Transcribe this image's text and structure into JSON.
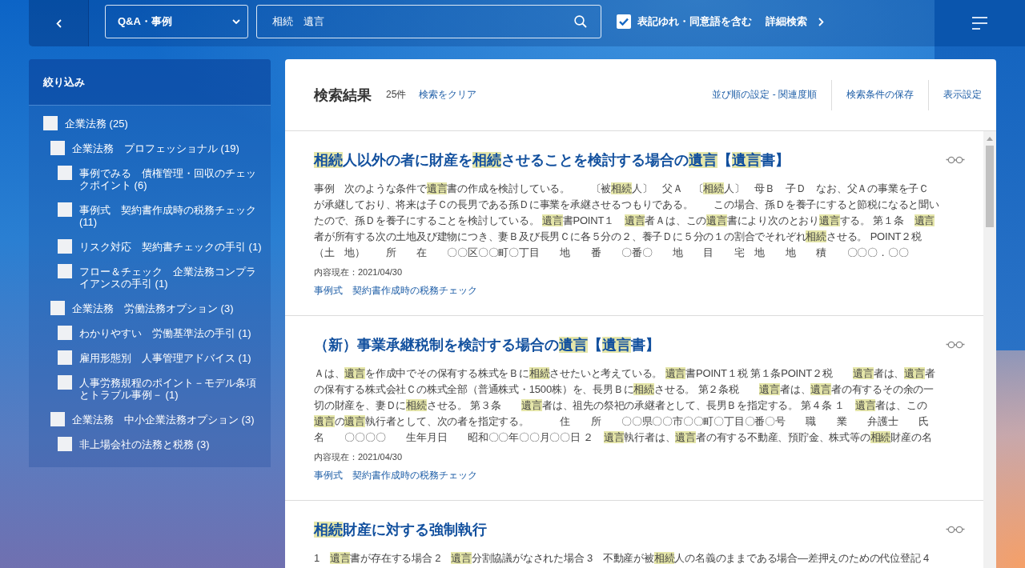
{
  "top_bar": {
    "category_select": {
      "value": "Q&A・事例"
    },
    "search": {
      "value": "相続　遺言"
    },
    "variant_option": {
      "label": "表記ゆれ・同意語を含む",
      "checked": true
    },
    "advanced_search": "詳細検索"
  },
  "sidebar": {
    "title": "絞り込み",
    "items": [
      {
        "label": "企業法務 (25)",
        "checked": false,
        "children": [
          {
            "label": "企業法務　プロフェッショナル (19)",
            "checked": false,
            "children": [
              {
                "label": "事例でみる　債権管理・回収のチェックポイント (6)",
                "checked": false
              },
              {
                "label": "事例式　契約書作成時の税務チェック (11)",
                "checked": false
              },
              {
                "label": "リスク対応　契約書チェックの手引 (1)",
                "checked": false
              },
              {
                "label": "フロー＆チェック　企業法務コンプライアンスの手引 (1)",
                "checked": false
              }
            ]
          },
          {
            "label": "企業法務　労働法務オプション (3)",
            "checked": false,
            "children": [
              {
                "label": "わかりやすい　労働基準法の手引 (1)",
                "checked": false
              },
              {
                "label": "雇用形態別　人事管理アドバイス (1)",
                "checked": false
              },
              {
                "label": "人事労務規程のポイント－モデル条項とトラブル事例－ (1)",
                "checked": false
              }
            ]
          },
          {
            "label": "企業法務　中小企業法務オプション (3)",
            "checked": false,
            "children": [
              {
                "label": "非上場会社の法務と税務 (3)",
                "checked": false
              }
            ]
          }
        ]
      }
    ]
  },
  "results": {
    "title": "検索結果",
    "count": "25件",
    "clear": "検索をクリア",
    "actions": [
      "並び順の設定 - 関連度順",
      "検索条件の保存",
      "表示設定"
    ],
    "items": [
      {
        "title": [
          {
            "text": "相続",
            "highlighted": true
          },
          {
            "text": "人以外の者に財産を",
            "highlighted": false
          },
          {
            "text": "相続",
            "highlighted": true
          },
          {
            "text": "させることを検討する場合の",
            "highlighted": false
          },
          {
            "text": "遺言",
            "highlighted": true
          },
          {
            "text": "【",
            "highlighted": false
          },
          {
            "text": "遺言",
            "highlighted": true
          },
          {
            "text": "書】",
            "highlighted": false
          }
        ],
        "snippet_lines": [
          [
            {
              "text": "事例　次のような条件で",
              "highlighted": false
            },
            {
              "text": "遺言",
              "highlighted": true
            },
            {
              "text": "書の作成を検討している。　　〔被",
              "highlighted": false
            },
            {
              "text": "相続",
              "highlighted": true
            },
            {
              "text": "人〕　父Ａ　〔",
              "highlighted": false
            },
            {
              "text": "相続",
              "highlighted": true
            },
            {
              "text": "人〕　母Ｂ　子Ｄ　なお、父Ａの事業を子Ｃ",
              "highlighted": false
            }
          ],
          [
            {
              "text": "が承継しており、将来は子Ｃの長男である孫Ｄに事業を承継させるつもりである。　　この場合、孫Ｄを養子にすると節税になると聞い",
              "highlighted": false
            }
          ],
          [
            {
              "text": "たので、孫Ｄを養子にすることを検討している。 ",
              "highlighted": false
            },
            {
              "text": "遺言",
              "highlighted": true
            },
            {
              "text": "書POINT１　",
              "highlighted": false
            },
            {
              "text": "遺言",
              "highlighted": true
            },
            {
              "text": "者Ａは、この",
              "highlighted": false
            },
            {
              "text": "遺言",
              "highlighted": true
            },
            {
              "text": "書により次のとおり",
              "highlighted": false
            },
            {
              "text": "遺言",
              "highlighted": true
            },
            {
              "text": "する。 第１条　",
              "highlighted": false
            },
            {
              "text": "遺言",
              "highlighted": true
            }
          ],
          [
            {
              "text": "者が所有する次の土地及び建物につき、妻Ｂ及び長男Ｃに各５分の２、養子Ｄに５分の１の割合でそれぞれ",
              "highlighted": false
            },
            {
              "text": "相続",
              "highlighted": true
            },
            {
              "text": "させる。 POINT２税",
              "highlighted": false
            }
          ],
          [
            {
              "text": "（土　地）　　所　　在　　〇〇区〇〇町〇丁目　　地　　番　　〇番〇　　地　　目　　宅　地　　地　　積　　〇〇〇．〇〇",
              "highlighted": false
            }
          ]
        ],
        "date": "内容現在：2021/04/30",
        "source": "事例式　契約書作成時の税務チェック"
      },
      {
        "title": [
          {
            "text": "（新）事業承継税制を検討する場合の",
            "highlighted": false
          },
          {
            "text": "遺言",
            "highlighted": true
          },
          {
            "text": "【",
            "highlighted": false
          },
          {
            "text": "遺言",
            "highlighted": true
          },
          {
            "text": "書】",
            "highlighted": false
          }
        ],
        "snippet_lines": [
          [
            {
              "text": "Ａは、",
              "highlighted": false
            },
            {
              "text": "遺言",
              "highlighted": true
            },
            {
              "text": "を作成中でその保有する株式をＢに",
              "highlighted": false
            },
            {
              "text": "相続",
              "highlighted": true
            },
            {
              "text": "させたいと考えている。 ",
              "highlighted": false
            },
            {
              "text": "遺言",
              "highlighted": true
            },
            {
              "text": "書POINT１税 第１条POINT２税　　",
              "highlighted": false
            },
            {
              "text": "遺言",
              "highlighted": true
            },
            {
              "text": "者は、",
              "highlighted": false
            },
            {
              "text": "遺言",
              "highlighted": true
            },
            {
              "text": "者",
              "highlighted": false
            }
          ],
          [
            {
              "text": "の保有する株式会社Ｃの株式全部（普通株式・1500株）を、長男Ｂに",
              "highlighted": false
            },
            {
              "text": "相続",
              "highlighted": true
            },
            {
              "text": "させる。 第２条税　　",
              "highlighted": false
            },
            {
              "text": "遺言",
              "highlighted": true
            },
            {
              "text": "者は、",
              "highlighted": false
            },
            {
              "text": "遺言",
              "highlighted": true
            },
            {
              "text": "者の有するその余の一",
              "highlighted": false
            }
          ],
          [
            {
              "text": "切の財産を、妻Ｄに",
              "highlighted": false
            },
            {
              "text": "相続",
              "highlighted": true
            },
            {
              "text": "させる。 第３条　　",
              "highlighted": false
            },
            {
              "text": "遺言",
              "highlighted": true
            },
            {
              "text": "者は、祖先の祭祀の承継者として、長男Ｂを指定する。 第４条 １　",
              "highlighted": false
            },
            {
              "text": "遺言",
              "highlighted": true
            },
            {
              "text": "者は、この",
              "highlighted": false
            }
          ],
          [
            {
              "text": "遺言",
              "highlighted": true
            },
            {
              "text": "の",
              "highlighted": false
            },
            {
              "text": "遺言",
              "highlighted": true
            },
            {
              "text": "執行者として、次の者を指定する。　　　住　　所　　〇〇県〇〇市〇〇町〇丁目〇番〇号　　職　　業　　弁護士　　氏",
              "highlighted": false
            }
          ],
          [
            {
              "text": "名　　〇〇〇〇　　生年月日　　昭和〇〇年〇〇月〇〇日 ２　",
              "highlighted": false
            },
            {
              "text": "遺言",
              "highlighted": true
            },
            {
              "text": "執行者は、",
              "highlighted": false
            },
            {
              "text": "遺言",
              "highlighted": true
            },
            {
              "text": "者の有する不動産、預貯金、株式等の",
              "highlighted": false
            },
            {
              "text": "相続",
              "highlighted": true
            },
            {
              "text": "財産の名",
              "highlighted": false
            }
          ]
        ],
        "date": "内容現在：2021/04/30",
        "source": "事例式　契約書作成時の税務チェック"
      },
      {
        "title": [
          {
            "text": "相続",
            "highlighted": true
          },
          {
            "text": "財産に対する強制執行",
            "highlighted": false
          }
        ],
        "snippet_lines": [
          [
            {
              "text": "1　",
              "highlighted": false
            },
            {
              "text": "遺言",
              "highlighted": true
            },
            {
              "text": "書が存在する場合 2　",
              "highlighted": false
            },
            {
              "text": "遺言",
              "highlighted": true
            },
            {
              "text": "分割協議がなされた場合 3　不動産が被",
              "highlighted": false
            },
            {
              "text": "相続",
              "highlighted": true
            },
            {
              "text": "人の名義のままである場合―差押えのための代位登記 4",
              "highlighted": false
            }
          ]
        ]
      }
    ]
  }
}
